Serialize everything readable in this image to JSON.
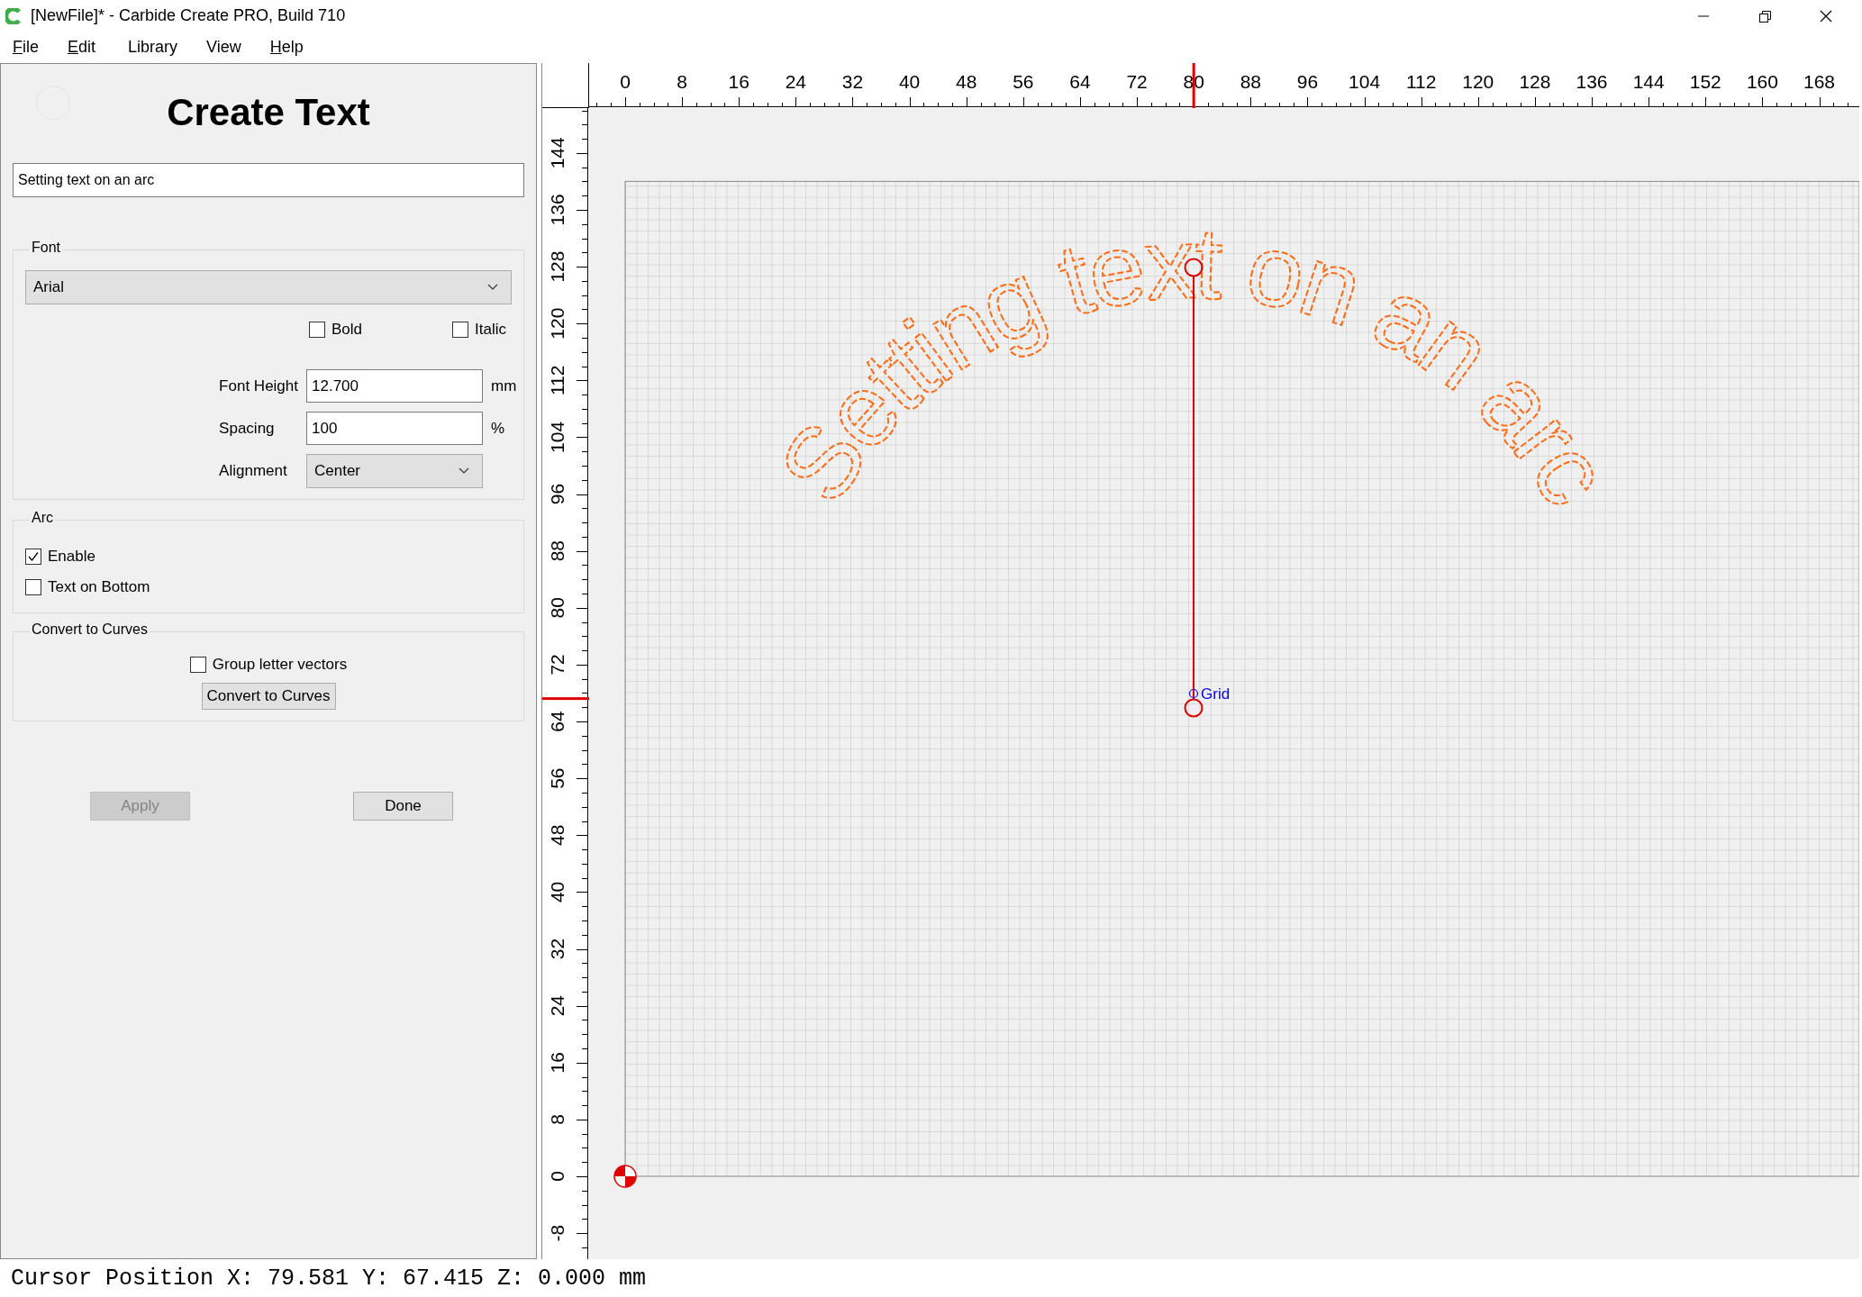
{
  "window": {
    "title": "[NewFile]* - Carbide Create PRO, Build 710"
  },
  "menu": [
    {
      "label": "File",
      "mnemonic": true
    },
    {
      "label": "Edit",
      "mnemonic": true
    },
    {
      "label": "Library",
      "mnemonic": false
    },
    {
      "label": "View",
      "mnemonic": false
    },
    {
      "label": "Help",
      "mnemonic": true
    }
  ],
  "panel": {
    "title": "Create Text",
    "text_value": "Setting text on an arc",
    "font": {
      "title": "Font",
      "family": "Arial",
      "checks": [
        {
          "label": "Bold",
          "checked": false
        },
        {
          "label": "Italic",
          "checked": false
        }
      ],
      "fields": [
        {
          "kind": "input",
          "label": "Font Height",
          "value": "12.700",
          "unit": "mm"
        },
        {
          "kind": "input",
          "label": "Spacing",
          "value": "100",
          "unit": "%"
        },
        {
          "kind": "select",
          "label": "Alignment",
          "value": "Center"
        }
      ]
    },
    "arc": {
      "title": "Arc",
      "checks": [
        {
          "label": "Enable",
          "checked": true
        },
        {
          "label": "Text on Bottom",
          "checked": false
        }
      ]
    },
    "convert": {
      "title": "Convert to Curves",
      "checks": [
        {
          "label": "Group letter vectors",
          "checked": false
        }
      ],
      "button": "Convert to Curves"
    },
    "buttons": [
      {
        "label": "Apply",
        "disabled": true
      },
      {
        "label": "Done",
        "disabled": false
      }
    ]
  },
  "rulers": {
    "x": {
      "labels": [
        "0",
        "8",
        "16",
        "24",
        "32",
        "40",
        "48",
        "56",
        "64",
        "72",
        "80",
        "88",
        "96",
        "104",
        "112",
        "120",
        "128",
        "136",
        "144",
        "152",
        "160",
        "168"
      ],
      "level": 0.476
    },
    "y": {
      "labels": [
        "-8",
        "0",
        "8",
        "16",
        "24",
        "32",
        "40",
        "48",
        "56",
        "64",
        "72",
        "80",
        "88",
        "96",
        "104",
        "112",
        "120",
        "128",
        "136",
        "144"
      ],
      "level": 0.513
    }
  },
  "canvas": {
    "text": "Setting text on an arc",
    "grid_label": "Grid"
  },
  "status_bar": "Cursor Position X: 79.581 Y: 67.415 Z: 0.000 mm"
}
